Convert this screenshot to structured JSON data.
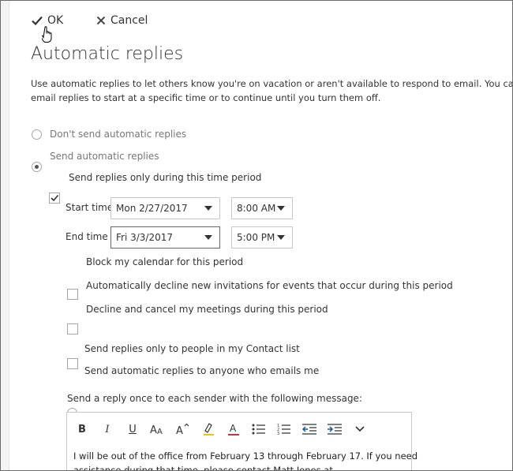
{
  "toolbar": {
    "ok_label": "OK",
    "cancel_label": "Cancel"
  },
  "page": {
    "title": "Automatic replies",
    "description_line1": "Use automatic replies to let others know you're on vacation or aren't available to respond to email. You can set your",
    "description_line2": "email replies to start at a specific time or to continue until you turn them off."
  },
  "options": {
    "dont_send": {
      "label": "Don't send automatic replies",
      "selected": false
    },
    "send": {
      "label": "Send automatic replies",
      "selected": true
    },
    "time_period": {
      "label": "Send replies only during this time period",
      "checked": true
    }
  },
  "schedule": {
    "start_label": "Start time",
    "start_date": "Mon 2/27/2017",
    "start_time": "8:00 AM",
    "end_label": "End time",
    "end_date": "Fri 3/3/2017",
    "end_time": "5:00 PM"
  },
  "extra_options": [
    {
      "label": "Block my calendar for this period",
      "checked": false
    },
    {
      "label": "Automatically decline new invitations for events that occur during this period",
      "checked": false
    },
    {
      "label": "Decline and cancel my meetings during this period",
      "checked": false
    }
  ],
  "audience": {
    "contacts_only": {
      "label": "Send replies only to people in my Contact list",
      "selected": false
    },
    "anyone": {
      "label": "Send automatic replies to anyone who emails me",
      "selected": true
    }
  },
  "message": {
    "prompt": "Send a reply once to each sender with the following message:",
    "line1": "I will be out of the office from February 13 through February 17. If you need",
    "line2": "assistance during that time, please contact Matt Jones at"
  },
  "editor_toolbar": [
    "bold-icon",
    "italic-icon",
    "underline-icon",
    "font-size-icon",
    "grow-font-icon",
    "highlight-icon",
    "font-color-icon",
    "bullets-icon",
    "numbering-icon",
    "decrease-indent-icon",
    "increase-indent-icon",
    "more-options-icon"
  ],
  "colors": {
    "highlight": "#f2c200",
    "font_color": "#d32f2f",
    "indent_arrow": "#0b5aa8"
  }
}
